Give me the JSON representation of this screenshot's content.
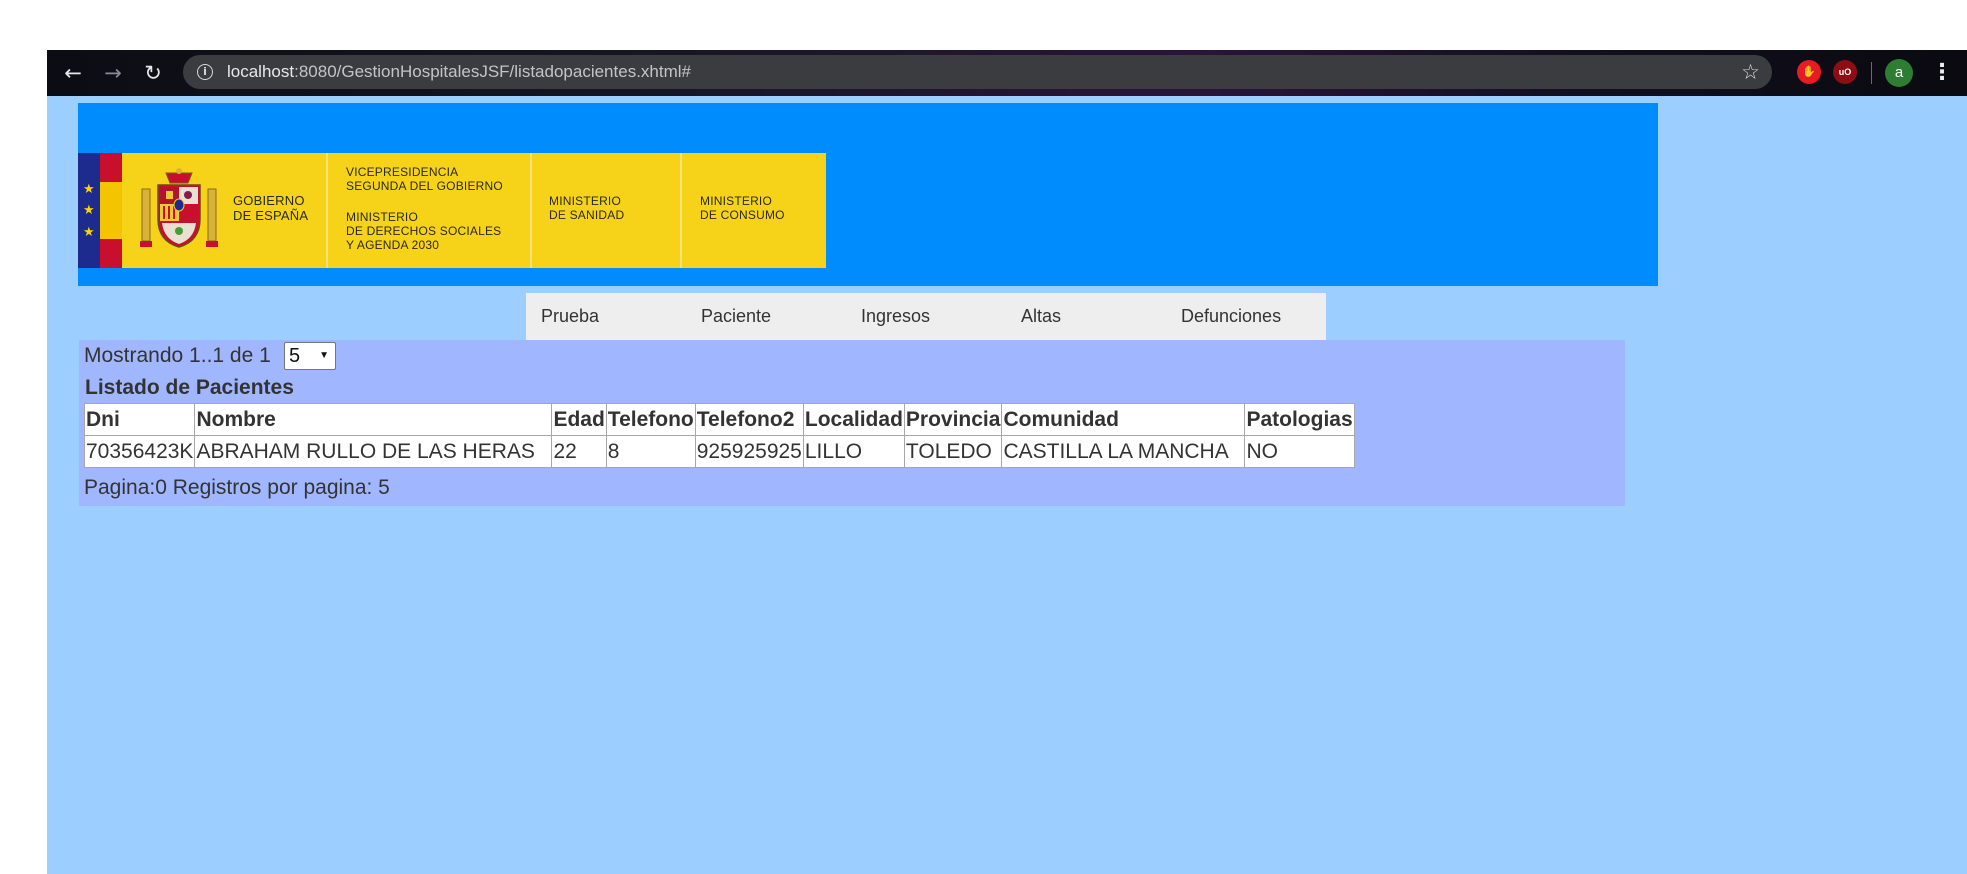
{
  "browser": {
    "url_host": "localhost",
    "url_path": ":8080/GestionHospitalesJSF/listadopacientes.xhtml#",
    "avatar_initial": "a",
    "colors": {
      "toolbar": "#121220",
      "omnibox": "#3b3c40"
    }
  },
  "header": {
    "logo": {
      "gobierno": "GOBIERNO\nDE ESPAÑA",
      "vicepresidencia": "VICEPRESIDENCIA\nSEGUNDA DEL GOBIERNO",
      "ministerio_derechos": "MINISTERIO\nDE DERECHOS SOCIALES\nY AGENDA 2030",
      "ministerio_sanidad": "MINISTERIO\nDE SANIDAD",
      "ministerio_consumo": "MINISTERIO\nDE CONSUMO"
    },
    "colors": {
      "banner": "#008cfc",
      "logo_bg": "#f6d318"
    }
  },
  "nav": {
    "items": [
      "Prueba",
      "Paciente",
      "Ingresos",
      "Altas",
      "Defunciones"
    ]
  },
  "listing": {
    "showing_label": "Mostrando 1..1 de 1",
    "rows_per_page_selected": "5",
    "table_title": "Listado de Pacientes",
    "columns": [
      "Dni",
      "Nombre",
      "Edad",
      "Telefono",
      "Telefono2",
      "Localidad",
      "Provincia",
      "Comunidad",
      "Patologias"
    ],
    "rows": [
      [
        "70356423K",
        "ABRAHAM RULLO DE LAS HERAS",
        "22",
        "8",
        "925925925",
        "LILLO",
        "TOLEDO",
        "CASTILLA LA MANCHA",
        "NO"
      ]
    ],
    "footer": "Pagina:0 Registros por pagina: 5"
  },
  "colors": {
    "page_bg": "#9ccfff",
    "content_bg": "#a0b7ff"
  }
}
